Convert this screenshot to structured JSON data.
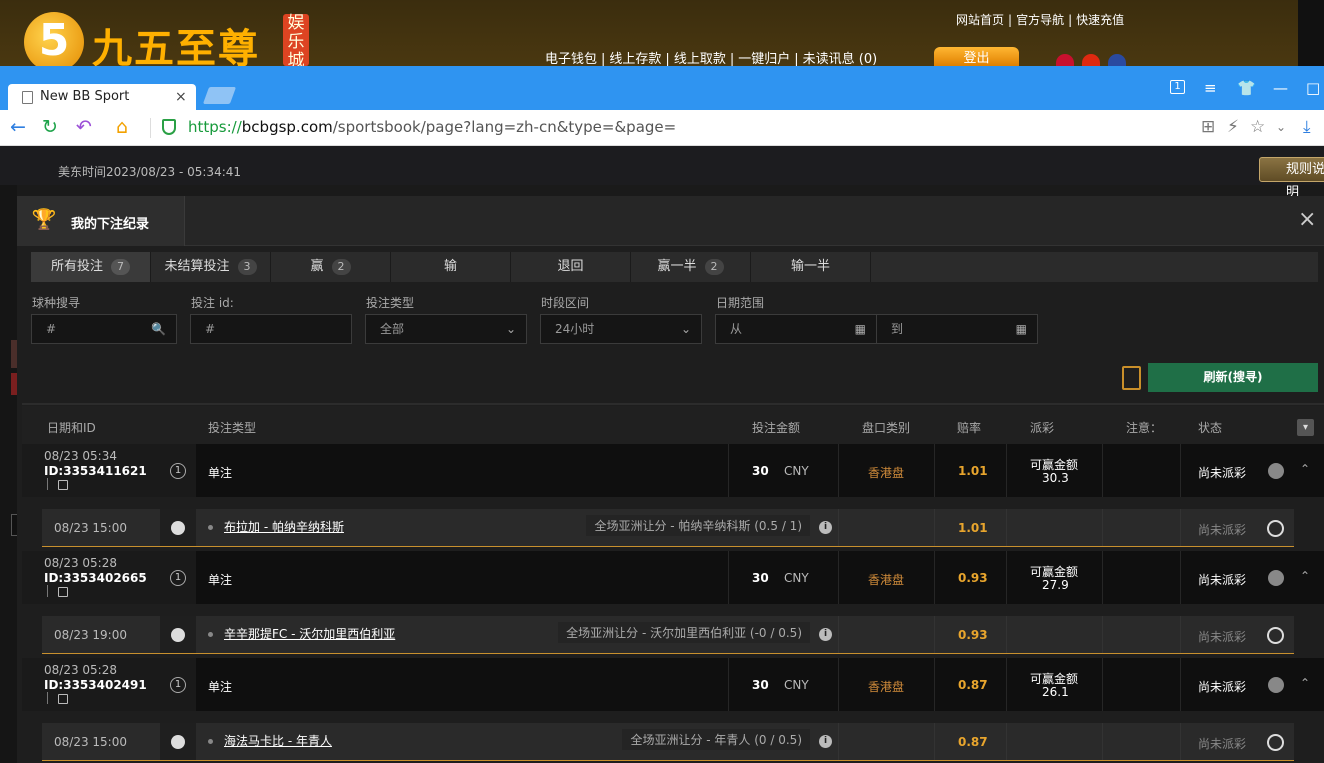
{
  "site": {
    "logo_digit": "5",
    "logo_text": "九五至尊",
    "logo_badge": "娱乐城",
    "top_links": [
      "网站首页",
      "官方导航",
      "快速充值"
    ],
    "mid_links": [
      "电子钱包",
      "线上存款",
      "线上取款",
      "一键归户",
      "未读讯息 (0)"
    ],
    "login_label": "登出",
    "separator": "|"
  },
  "browser": {
    "tab_title": "New BB Sport",
    "tab_close": "×",
    "url_https": "https://",
    "url_host": "bcbgsp.com",
    "url_path": "/sportsbook/page?lang=zh-cn&type=&page=",
    "window_controls": [
      "1",
      "≡",
      "👕",
      "—",
      "□"
    ],
    "nav_icons": [
      "←",
      "↻",
      "↶",
      "⌂"
    ],
    "right_tools": [
      "⊞",
      "⚡",
      "☆",
      "⌄",
      "⤓"
    ]
  },
  "sportsbook": {
    "time_label": "美东时间2023/08/23 - 05:34:41",
    "rules_label": "规则说明"
  },
  "panel": {
    "title": "我的下注纪录",
    "close": "×",
    "tabs": [
      {
        "label": "所有投注",
        "count": "7"
      },
      {
        "label": "未结算投注",
        "count": "3"
      },
      {
        "label": "赢",
        "count": "2"
      },
      {
        "label": "输",
        "count": ""
      },
      {
        "label": "退回",
        "count": ""
      },
      {
        "label": "赢一半",
        "count": "2"
      },
      {
        "label": "输一半",
        "count": ""
      }
    ],
    "filters": {
      "sport_label": "球种搜寻",
      "sport_placeholder": "#",
      "betid_label": "投注 id:",
      "betid_placeholder": "#",
      "bettype_label": "投注类型",
      "bettype_value": "全部",
      "period_label": "时段区间",
      "period_value": "24小时",
      "date_label": "日期范围",
      "date_from": "从",
      "date_to": "到"
    },
    "refresh_label": "刷新(搜寻)",
    "columns": [
      "日期和ID",
      "投注类型",
      "投注金额",
      "盘口类别",
      "赔率",
      "派彩",
      "注意：",
      "状态"
    ],
    "collapse_icon": "▾",
    "bets": [
      {
        "date": "08/23 05:34",
        "id": "ID:3353411621",
        "num": "1",
        "type": "单注",
        "amount": "30",
        "currency": "CNY",
        "market": "香港盘",
        "odds": "1.01",
        "payout_label": "可赢金额",
        "payout": "30.3",
        "status": "尚未派彩",
        "detail": {
          "date": "08/23 15:00",
          "match": "布拉加 - 帕纳辛纳科斯",
          "handicap": "全场亚洲让分 - 帕纳辛纳科斯 (0.5 / 1)",
          "odds": "1.01",
          "status": "尚未派彩"
        }
      },
      {
        "date": "08/23 05:28",
        "id": "ID:3353402665",
        "num": "1",
        "type": "单注",
        "amount": "30",
        "currency": "CNY",
        "market": "香港盘",
        "odds": "0.93",
        "payout_label": "可赢金额",
        "payout": "27.9",
        "status": "尚未派彩",
        "detail": {
          "date": "08/23 19:00",
          "match": "辛辛那提FC - 沃尔加里西伯利亚",
          "handicap": "全场亚洲让分 - 沃尔加里西伯利亚 (-0 / 0.5)",
          "odds": "0.93",
          "status": "尚未派彩"
        }
      },
      {
        "date": "08/23 05:28",
        "id": "ID:3353402491",
        "num": "1",
        "type": "单注",
        "amount": "30",
        "currency": "CNY",
        "market": "香港盘",
        "odds": "0.87",
        "payout_label": "可赢金额",
        "payout": "26.1",
        "status": "尚未派彩",
        "detail": {
          "date": "08/23 15:00",
          "match": "海法马卡比 - 年青人",
          "handicap": "全场亚洲让分 - 年青人 (0 / 0.5)",
          "odds": "0.87",
          "status": "尚未派彩"
        }
      }
    ]
  }
}
